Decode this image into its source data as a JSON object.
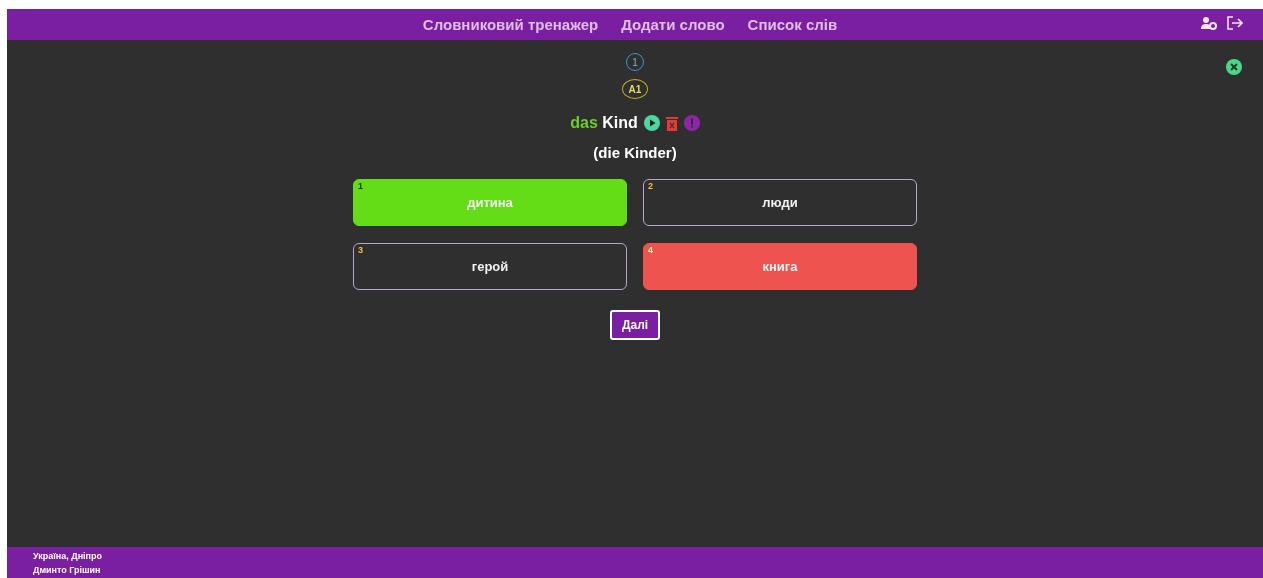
{
  "nav": {
    "links": [
      {
        "label": "Словниковий тренажер"
      },
      {
        "label": "Додати слово"
      },
      {
        "label": "Список слів"
      }
    ]
  },
  "card": {
    "counter": "1",
    "level_badge": "A1",
    "article": "das",
    "word": "Kind",
    "plural": "(die Kinder)",
    "options": [
      {
        "number": "1",
        "text": "дитина",
        "correct": true,
        "wrong": false
      },
      {
        "number": "2",
        "text": "люди",
        "correct": false,
        "wrong": false
      },
      {
        "number": "3",
        "text": "герой",
        "correct": false,
        "wrong": false
      },
      {
        "number": "4",
        "text": "книга",
        "correct": false,
        "wrong": true
      }
    ],
    "next_button": "Далі"
  },
  "footer": {
    "lines": [
      "Україна, Дніпро",
      "Дминто Грішин"
    ]
  }
}
